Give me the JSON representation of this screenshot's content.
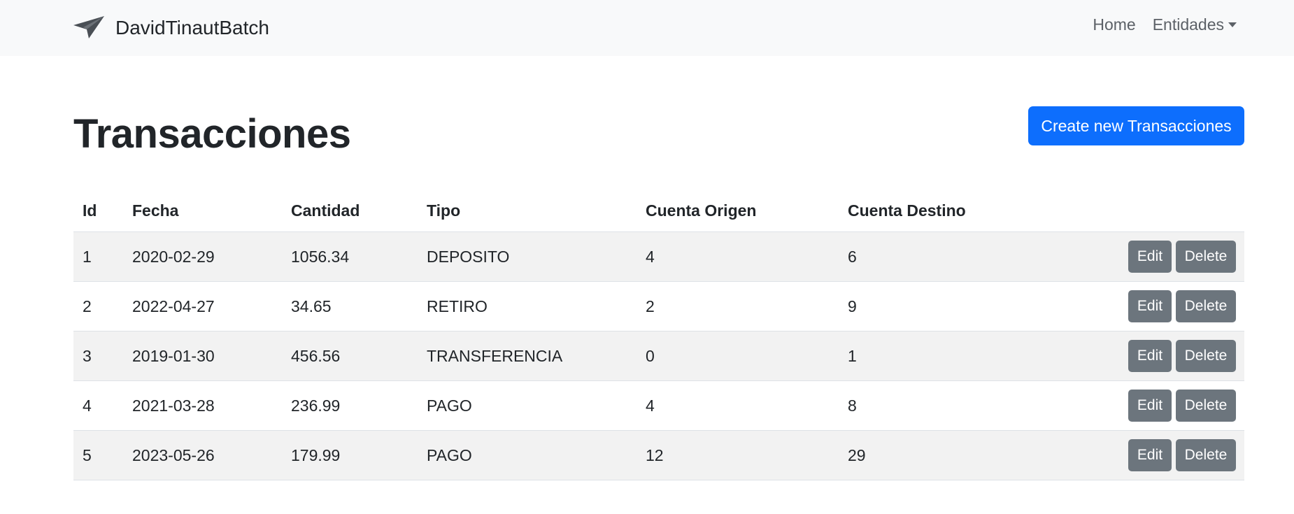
{
  "navbar": {
    "brand": "DavidTinautBatch",
    "brand_icon": "paper-plane-icon",
    "links": {
      "home": "Home",
      "entidades": "Entidades"
    }
  },
  "page": {
    "title": "Transacciones",
    "create_button": "Create new Transacciones"
  },
  "table": {
    "headers": [
      "Id",
      "Fecha",
      "Cantidad",
      "Tipo",
      "Cuenta Origen",
      "Cuenta Destino"
    ],
    "rows": [
      {
        "id": "1",
        "fecha": "2020-02-29",
        "cantidad": "1056.34",
        "tipo": "DEPOSITO",
        "origen": "4",
        "destino": "6"
      },
      {
        "id": "2",
        "fecha": "2022-04-27",
        "cantidad": "34.65",
        "tipo": "RETIRO",
        "origen": "2",
        "destino": "9"
      },
      {
        "id": "3",
        "fecha": "2019-01-30",
        "cantidad": "456.56",
        "tipo": "TRANSFERENCIA",
        "origen": "0",
        "destino": "1"
      },
      {
        "id": "4",
        "fecha": "2021-03-28",
        "cantidad": "236.99",
        "tipo": "PAGO",
        "origen": "4",
        "destino": "8"
      },
      {
        "id": "5",
        "fecha": "2023-05-26",
        "cantidad": "179.99",
        "tipo": "PAGO",
        "origen": "12",
        "destino": "29"
      }
    ],
    "edit_label": "Edit",
    "delete_label": "Delete"
  },
  "colors": {
    "primary": "#0d6efd",
    "secondary": "#6c757d",
    "navbar_bg": "#f8f9fa",
    "stripe": "#f2f2f2"
  }
}
